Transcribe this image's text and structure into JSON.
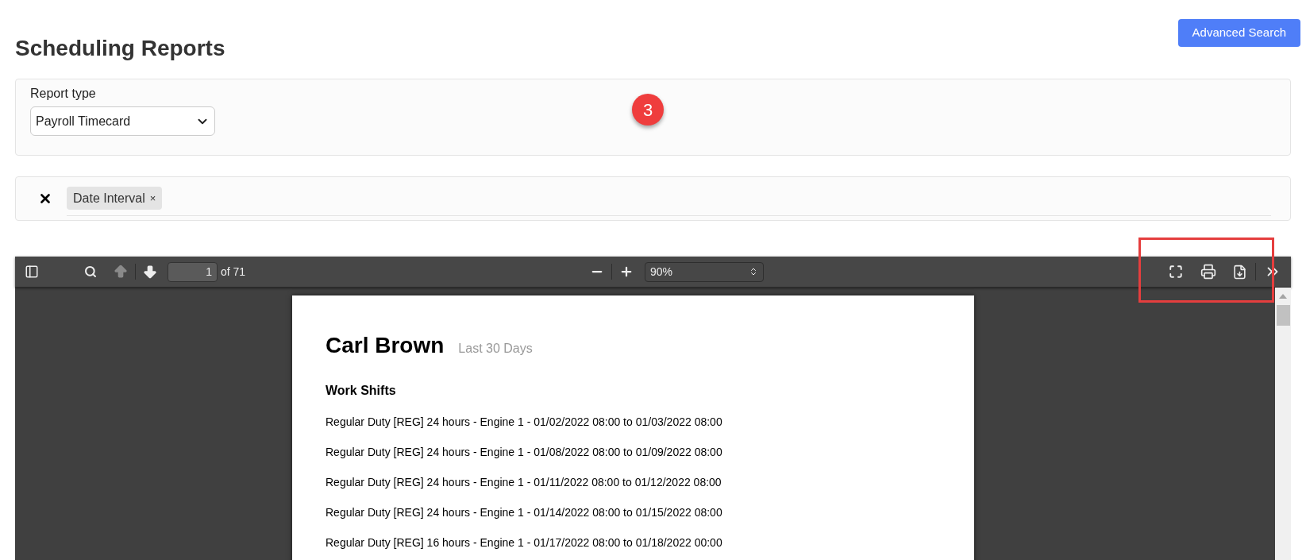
{
  "page": {
    "title": "Scheduling Reports",
    "action_button": "Advanced Search"
  },
  "report_type": {
    "label": "Report type",
    "value": "Payroll Timecard"
  },
  "step_badge": "3",
  "filters": {
    "chips": [
      {
        "label": "Date Interval",
        "remove": "×"
      }
    ]
  },
  "pdf_viewer": {
    "toolbar": {
      "page_input": "1",
      "page_count": "of 71",
      "previous_disabled": true,
      "zoom": "90%"
    },
    "document": {
      "name": "Carl Brown",
      "period": "Last 30 Days",
      "section": "Work Shifts",
      "lines": [
        "Regular Duty [REG] 24 hours - Engine 1 - 01/02/2022 08:00 to 01/03/2022 08:00",
        "Regular Duty [REG] 24 hours - Engine 1 - 01/08/2022 08:00 to 01/09/2022 08:00",
        "Regular Duty [REG] 24 hours - Engine 1 - 01/11/2022 08:00 to 01/12/2022 08:00",
        "Regular Duty [REG] 24 hours - Engine 1 - 01/14/2022 08:00 to 01/15/2022 08:00",
        "Regular Duty [REG] 16 hours - Engine 1 - 01/17/2022 08:00 to 01/18/2022 00:00"
      ]
    }
  }
}
